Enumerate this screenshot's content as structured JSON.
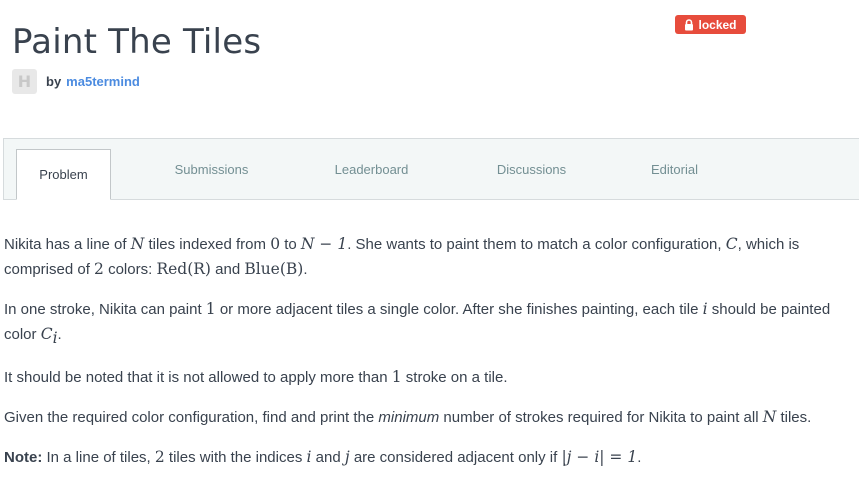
{
  "header": {
    "title": "Paint The Tiles",
    "badge_label": "locked",
    "avatar_letter": "H",
    "by_label": "by",
    "author": "ma5termind"
  },
  "tabs": [
    {
      "label": "Problem",
      "active": true
    },
    {
      "label": "Submissions",
      "active": false
    },
    {
      "label": "Leaderboard",
      "active": false
    },
    {
      "label": "Discussions",
      "active": false
    },
    {
      "label": "Editorial",
      "active": false
    }
  ],
  "problem": {
    "p1": {
      "t1": "Nikita has a line of ",
      "m1": "N",
      "t2": " tiles indexed from ",
      "m2": "0",
      "t3": " to ",
      "m3": "N − 1",
      "t4": ". She wants to paint them to match a color configuration, ",
      "m4": "C",
      "t5": ", which is comprised of ",
      "m5": "2",
      "t6": " colors: ",
      "m6": "Red(R)",
      "t7": " and ",
      "m7": "Blue(B)",
      "t8": "."
    },
    "p2": {
      "t1": "In one stroke, Nikita can paint ",
      "m1": "1",
      "t2": " or more adjacent tiles a single color. After she finishes painting, each tile ",
      "m2": "i",
      "t3": " should be painted color ",
      "m3": "C",
      "m3sub": "i",
      "t4": "."
    },
    "p3": {
      "t1": "It should be noted that it is not allowed to apply more than ",
      "m1": "1",
      "t2": " stroke on a tile."
    },
    "p4": {
      "t1": "Given the required color configuration, find and print the ",
      "em": "minimum",
      "t2": " number of strokes required for Nikita to paint all ",
      "m1": "N",
      "t3": " tiles."
    },
    "p5": {
      "label": "Note:",
      "t1": " In a line of tiles, ",
      "m1": "2",
      "t2": " tiles with the indices ",
      "m2": "i",
      "t3": " and ",
      "m3": "j",
      "t4": " are considered adjacent only if ",
      "m4": "|j − i| = 1",
      "t5": "."
    }
  },
  "colors": {
    "badge": "#e74c3c",
    "link": "#4b8be0",
    "text": "#39424e",
    "tab_bar": "#f3f7f7"
  }
}
